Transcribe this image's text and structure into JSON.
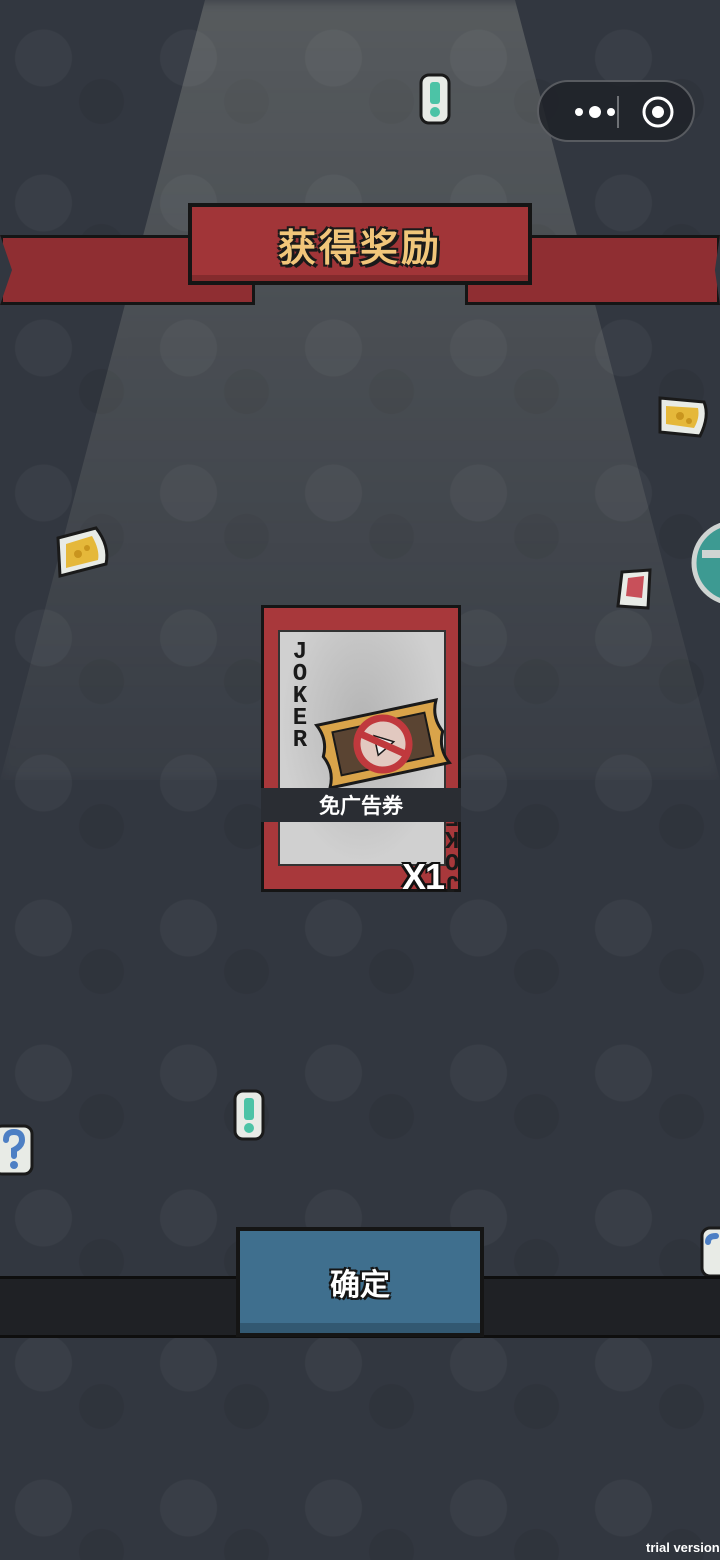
{
  "banner": {
    "title": "获得奖励"
  },
  "reward_card": {
    "corner_text": "JOKER",
    "item_name": "免广告券",
    "quantity": "X1"
  },
  "confirm_button": {
    "label": "确定"
  },
  "watermark": {
    "text": "trial version"
  },
  "colors": {
    "background": "#323740",
    "banner_red": "#a13538",
    "banner_text": "#f1c67a",
    "button_blue": "#3f6f8e"
  },
  "icons": [
    "more-dots-icon",
    "close-target-icon",
    "no-ad-ticket-icon",
    "exclamation-sticker-icon",
    "cheese-sticker-icon",
    "question-sticker-icon"
  ]
}
